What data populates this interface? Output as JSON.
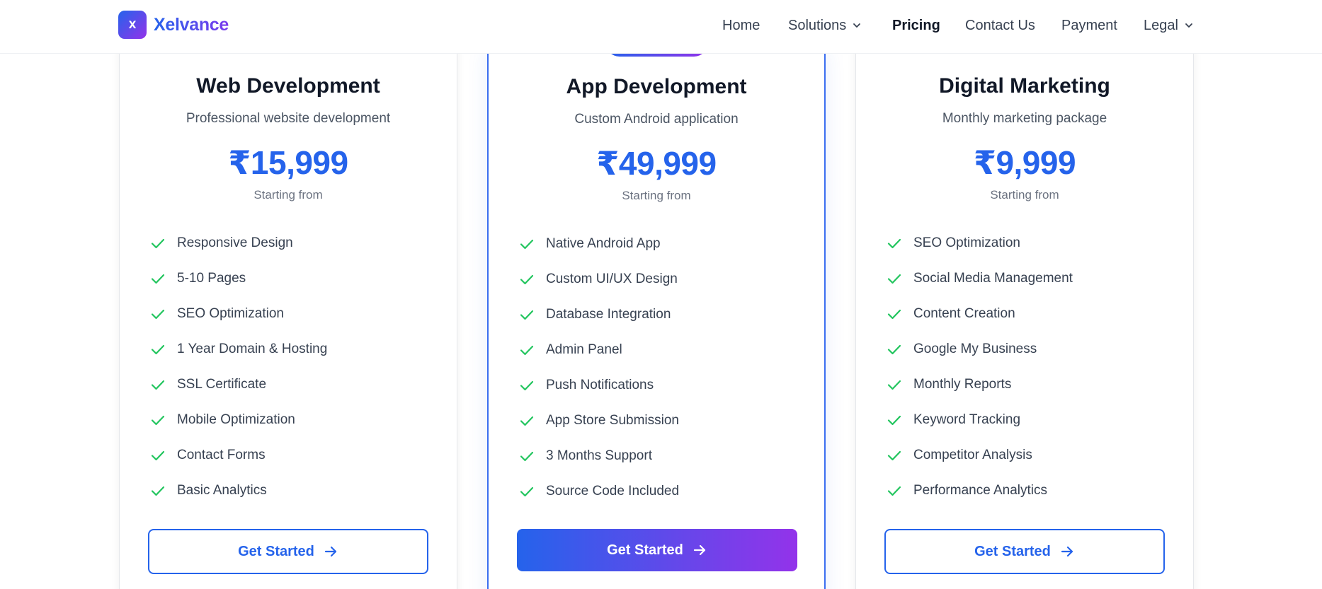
{
  "header": {
    "logo_letter": "x",
    "brand": "Xelvance",
    "nav": [
      {
        "label": "Home"
      },
      {
        "label": "Solutions"
      },
      {
        "label": "Pricing"
      },
      {
        "label": "Contact Us"
      },
      {
        "label": "Payment"
      },
      {
        "label": "Legal"
      }
    ],
    "active": "Pricing"
  },
  "plans": [
    {
      "title": "Web Development",
      "subtitle": "Professional website development",
      "price": "₹15,999",
      "price_note": "Starting from",
      "features": [
        "Responsive Design",
        "5-10 Pages",
        "SEO Optimization",
        "1 Year Domain & Hosting",
        "SSL Certificate",
        "Mobile Optimization",
        "Contact Forms",
        "Basic Analytics"
      ],
      "cta": "Get Started",
      "featured": false
    },
    {
      "title": "App Development",
      "subtitle": "Custom Android application",
      "price": "₹49,999",
      "price_note": "Starting from",
      "features": [
        "Native Android App",
        "Custom UI/UX Design",
        "Database Integration",
        "Admin Panel",
        "Push Notifications",
        "App Store Submission",
        "3 Months Support",
        "Source Code Included"
      ],
      "cta": "Get Started",
      "featured": true
    },
    {
      "title": "Digital Marketing",
      "subtitle": "Monthly marketing package",
      "price": "₹9,999",
      "price_note": "Starting from",
      "features": [
        "SEO Optimization",
        "Social Media Management",
        "Content Creation",
        "Google My Business",
        "Monthly Reports",
        "Keyword Tracking",
        "Competitor Analysis",
        "Performance Analytics"
      ],
      "cta": "Get Started",
      "featured": false
    }
  ],
  "icons": {
    "logo": "logo-icon",
    "dropdown": "chevron-down-icon",
    "feature": "check-icon",
    "cta": "arrow-right-icon"
  },
  "colors": {
    "accent": "#2563eb",
    "accent_end": "#9333ea",
    "check": "#22c55e",
    "text": "#111827",
    "muted": "#6b7280"
  }
}
